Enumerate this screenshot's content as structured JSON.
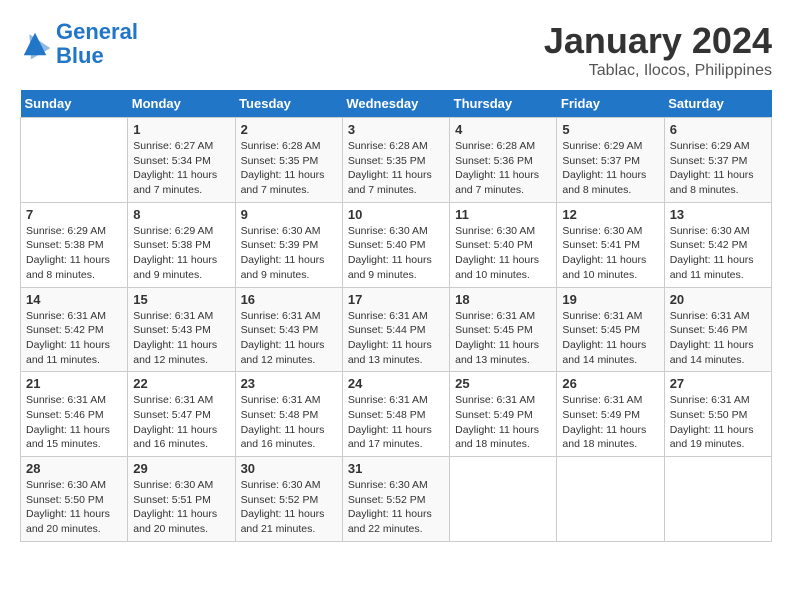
{
  "logo": {
    "line1": "General",
    "line2": "Blue"
  },
  "title": "January 2024",
  "subtitle": "Tablac, Ilocos, Philippines",
  "weekdays": [
    "Sunday",
    "Monday",
    "Tuesday",
    "Wednesday",
    "Thursday",
    "Friday",
    "Saturday"
  ],
  "weeks": [
    [
      {
        "num": "",
        "info": ""
      },
      {
        "num": "1",
        "info": "Sunrise: 6:27 AM\nSunset: 5:34 PM\nDaylight: 11 hours\nand 7 minutes."
      },
      {
        "num": "2",
        "info": "Sunrise: 6:28 AM\nSunset: 5:35 PM\nDaylight: 11 hours\nand 7 minutes."
      },
      {
        "num": "3",
        "info": "Sunrise: 6:28 AM\nSunset: 5:35 PM\nDaylight: 11 hours\nand 7 minutes."
      },
      {
        "num": "4",
        "info": "Sunrise: 6:28 AM\nSunset: 5:36 PM\nDaylight: 11 hours\nand 7 minutes."
      },
      {
        "num": "5",
        "info": "Sunrise: 6:29 AM\nSunset: 5:37 PM\nDaylight: 11 hours\nand 8 minutes."
      },
      {
        "num": "6",
        "info": "Sunrise: 6:29 AM\nSunset: 5:37 PM\nDaylight: 11 hours\nand 8 minutes."
      }
    ],
    [
      {
        "num": "7",
        "info": "Sunrise: 6:29 AM\nSunset: 5:38 PM\nDaylight: 11 hours\nand 8 minutes."
      },
      {
        "num": "8",
        "info": "Sunrise: 6:29 AM\nSunset: 5:38 PM\nDaylight: 11 hours\nand 9 minutes."
      },
      {
        "num": "9",
        "info": "Sunrise: 6:30 AM\nSunset: 5:39 PM\nDaylight: 11 hours\nand 9 minutes."
      },
      {
        "num": "10",
        "info": "Sunrise: 6:30 AM\nSunset: 5:40 PM\nDaylight: 11 hours\nand 9 minutes."
      },
      {
        "num": "11",
        "info": "Sunrise: 6:30 AM\nSunset: 5:40 PM\nDaylight: 11 hours\nand 10 minutes."
      },
      {
        "num": "12",
        "info": "Sunrise: 6:30 AM\nSunset: 5:41 PM\nDaylight: 11 hours\nand 10 minutes."
      },
      {
        "num": "13",
        "info": "Sunrise: 6:30 AM\nSunset: 5:42 PM\nDaylight: 11 hours\nand 11 minutes."
      }
    ],
    [
      {
        "num": "14",
        "info": "Sunrise: 6:31 AM\nSunset: 5:42 PM\nDaylight: 11 hours\nand 11 minutes."
      },
      {
        "num": "15",
        "info": "Sunrise: 6:31 AM\nSunset: 5:43 PM\nDaylight: 11 hours\nand 12 minutes."
      },
      {
        "num": "16",
        "info": "Sunrise: 6:31 AM\nSunset: 5:43 PM\nDaylight: 11 hours\nand 12 minutes."
      },
      {
        "num": "17",
        "info": "Sunrise: 6:31 AM\nSunset: 5:44 PM\nDaylight: 11 hours\nand 13 minutes."
      },
      {
        "num": "18",
        "info": "Sunrise: 6:31 AM\nSunset: 5:45 PM\nDaylight: 11 hours\nand 13 minutes."
      },
      {
        "num": "19",
        "info": "Sunrise: 6:31 AM\nSunset: 5:45 PM\nDaylight: 11 hours\nand 14 minutes."
      },
      {
        "num": "20",
        "info": "Sunrise: 6:31 AM\nSunset: 5:46 PM\nDaylight: 11 hours\nand 14 minutes."
      }
    ],
    [
      {
        "num": "21",
        "info": "Sunrise: 6:31 AM\nSunset: 5:46 PM\nDaylight: 11 hours\nand 15 minutes."
      },
      {
        "num": "22",
        "info": "Sunrise: 6:31 AM\nSunset: 5:47 PM\nDaylight: 11 hours\nand 16 minutes."
      },
      {
        "num": "23",
        "info": "Sunrise: 6:31 AM\nSunset: 5:48 PM\nDaylight: 11 hours\nand 16 minutes."
      },
      {
        "num": "24",
        "info": "Sunrise: 6:31 AM\nSunset: 5:48 PM\nDaylight: 11 hours\nand 17 minutes."
      },
      {
        "num": "25",
        "info": "Sunrise: 6:31 AM\nSunset: 5:49 PM\nDaylight: 11 hours\nand 18 minutes."
      },
      {
        "num": "26",
        "info": "Sunrise: 6:31 AM\nSunset: 5:49 PM\nDaylight: 11 hours\nand 18 minutes."
      },
      {
        "num": "27",
        "info": "Sunrise: 6:31 AM\nSunset: 5:50 PM\nDaylight: 11 hours\nand 19 minutes."
      }
    ],
    [
      {
        "num": "28",
        "info": "Sunrise: 6:30 AM\nSunset: 5:50 PM\nDaylight: 11 hours\nand 20 minutes."
      },
      {
        "num": "29",
        "info": "Sunrise: 6:30 AM\nSunset: 5:51 PM\nDaylight: 11 hours\nand 20 minutes."
      },
      {
        "num": "30",
        "info": "Sunrise: 6:30 AM\nSunset: 5:52 PM\nDaylight: 11 hours\nand 21 minutes."
      },
      {
        "num": "31",
        "info": "Sunrise: 6:30 AM\nSunset: 5:52 PM\nDaylight: 11 hours\nand 22 minutes."
      },
      {
        "num": "",
        "info": ""
      },
      {
        "num": "",
        "info": ""
      },
      {
        "num": "",
        "info": ""
      }
    ]
  ]
}
